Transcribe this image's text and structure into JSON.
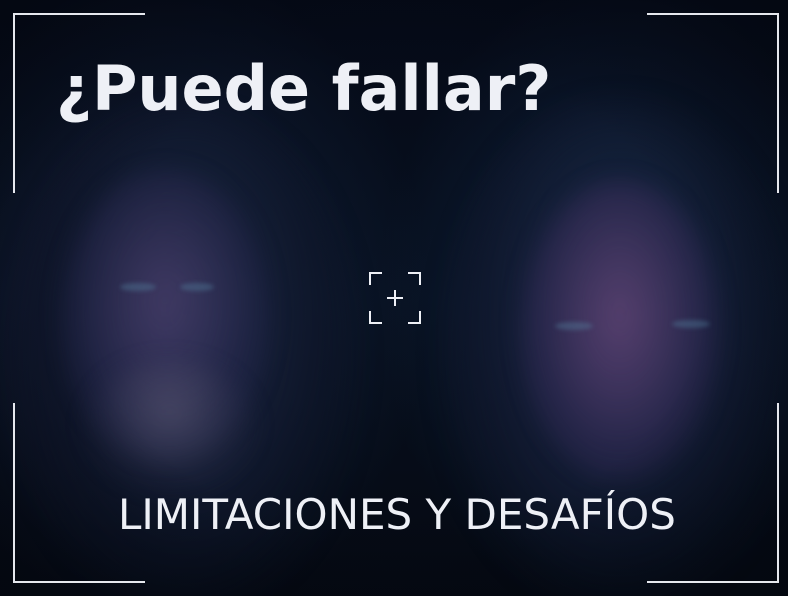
{
  "slide": {
    "title": "¿Puede fallar?",
    "subtitle": "LIMITACIONES Y DESAFÍOS"
  },
  "icons": {
    "expand": "expand-icon"
  },
  "colors": {
    "background": "#060b18",
    "text": "#eef0f6",
    "frame": "#e6e8ee"
  }
}
